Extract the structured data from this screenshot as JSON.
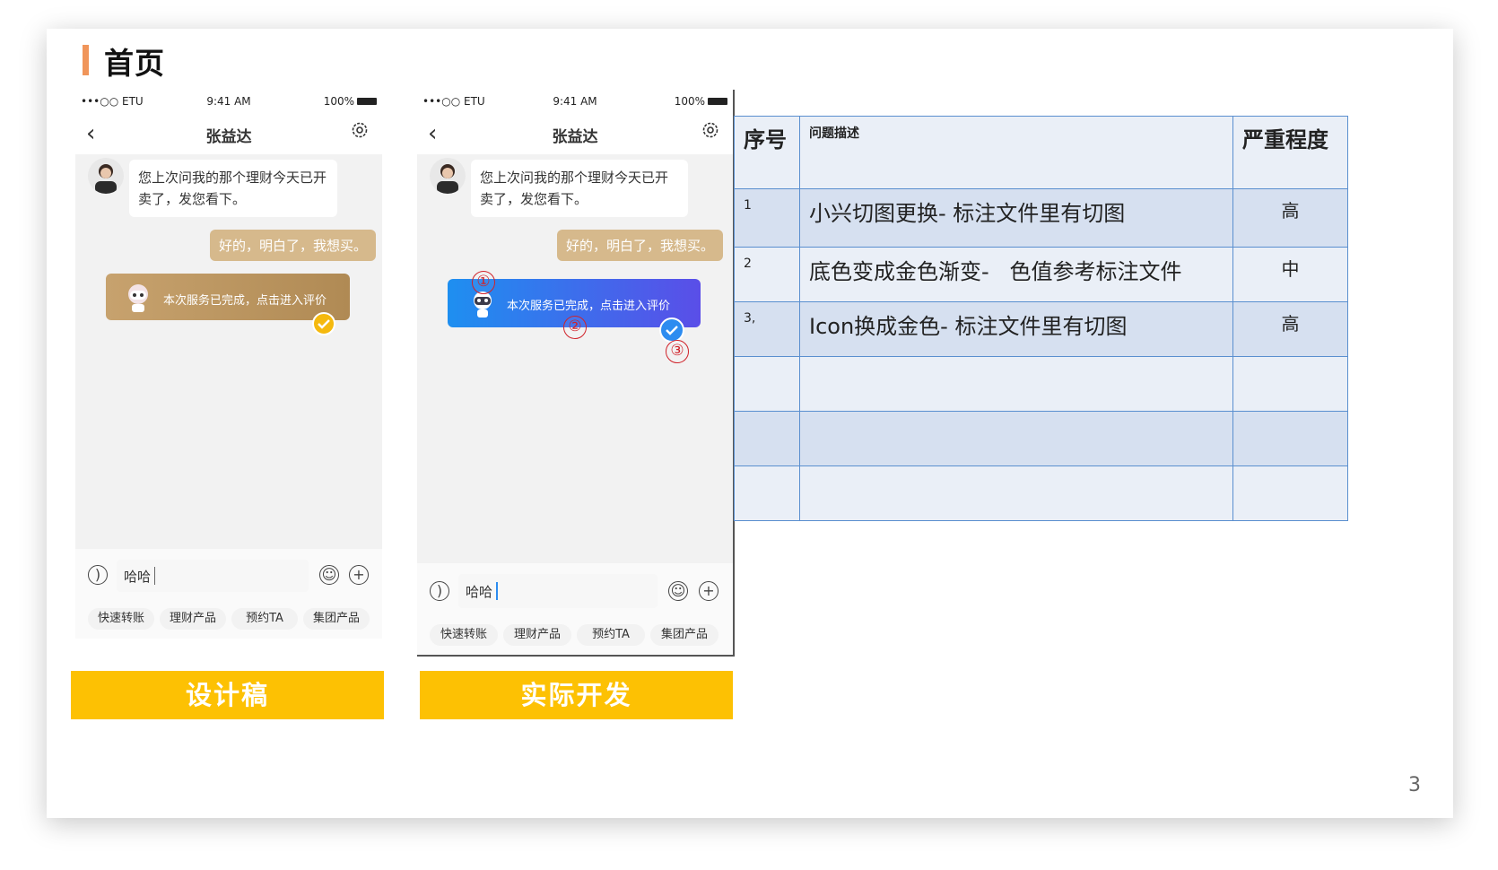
{
  "page": {
    "title": "首页",
    "page_number": "3"
  },
  "phones": [
    {
      "status": {
        "carrier": "•••○○ ETU",
        "time": "9:41 AM",
        "battery": "100%"
      },
      "contact_name": "张益达",
      "incoming_message": "您上次问我的那个理财今天已开卖了，发您看下。",
      "outgoing_message": "好的，明白了，我想买。",
      "service_card": "本次服务已完成，点击进入评价",
      "input_value": "哈哈",
      "quick_actions": [
        "快速转账",
        "理财产品",
        "预约TA",
        "集团产品"
      ],
      "caption": "设计稿",
      "colors": {
        "card": "#b8935e",
        "check": "#f5b90e"
      }
    },
    {
      "status": {
        "carrier": "•••○○ ETU",
        "time": "9:41 AM",
        "battery": "100%"
      },
      "contact_name": "张益达",
      "incoming_message": "您上次问我的那个理财今天已开卖了，发您看下。",
      "outgoing_message": "好的，明白了，我想买。",
      "service_card": "本次服务已完成，点击进入评价",
      "input_value": "哈哈",
      "quick_actions": [
        "快速转账",
        "理财产品",
        "预约TA",
        "集团产品"
      ],
      "caption": "实际开发",
      "colors": {
        "card": "#3f6fee",
        "check": "#2d8cf0"
      },
      "markers": [
        "①",
        "②",
        "③"
      ]
    }
  ],
  "issue_table": {
    "headers": [
      "序号",
      "问题描述",
      "严重程度"
    ],
    "rows": [
      {
        "no": "1",
        "desc": "小兴切图更换- 标注文件里有切图",
        "severity": "高"
      },
      {
        "no": "2",
        "desc": "底色变成金色渐变-   色值参考标注文件",
        "severity": "中"
      },
      {
        "no": "3,",
        "desc": "Icon换成金色- 标注文件里有切图",
        "severity": "高"
      },
      {
        "no": "",
        "desc": "",
        "severity": ""
      },
      {
        "no": "",
        "desc": "",
        "severity": ""
      },
      {
        "no": "",
        "desc": "",
        "severity": ""
      }
    ]
  }
}
